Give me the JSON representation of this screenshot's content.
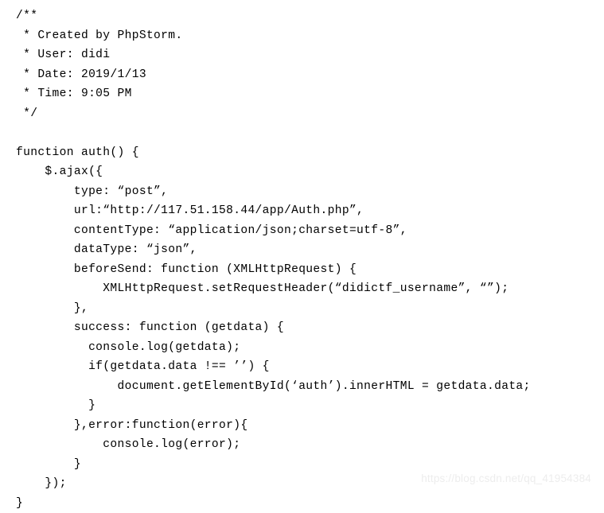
{
  "document": {
    "type": "source-code-listing",
    "language": "javascript",
    "background_color": "#ffffff",
    "text_color": "#000000"
  },
  "code": {
    "lines": [
      "/**",
      " * Created by PhpStorm.",
      " * User: didi",
      " * Date: 2019/1/13",
      " * Time: 9:05 PM",
      " */",
      "",
      "function auth() {",
      "    $.ajax({",
      "        type: “post”,",
      "        url:“http://117.51.158.44/app/Auth.php”,",
      "        contentType: “application/json;charset=utf-8”,",
      "        dataType: “json”,",
      "        beforeSend: function (XMLHttpRequest) {",
      "            XMLHttpRequest.setRequestHeader(“didictf_username”, “”);",
      "        },",
      "        success: function (getdata) {",
      "          console.log(getdata);",
      "          if(getdata.data !== ’’) {",
      "              document.getElementById(‘auth’).innerHTML = getdata.data;",
      "          }",
      "        },error:function(error){",
      "            console.log(error);",
      "        }",
      "    });",
      "}"
    ]
  },
  "watermark": {
    "text": "https://blog.csdn.net/qq_41954384",
    "color": "#ededed"
  }
}
